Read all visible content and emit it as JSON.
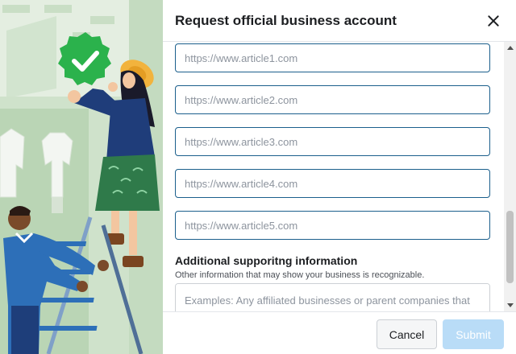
{
  "dialog": {
    "title": "Request official business account",
    "close_label": "close"
  },
  "form": {
    "articles": [
      {
        "placeholder": "https://www.article1.com"
      },
      {
        "placeholder": "https://www.article2.com"
      },
      {
        "placeholder": "https://www.article3.com"
      },
      {
        "placeholder": "https://www.article4.com"
      },
      {
        "placeholder": "https://www.article5.com"
      }
    ],
    "additional": {
      "title": "Additional supporitng information",
      "subtitle": "Other information that may show your business is recognizable.",
      "placeholder": "Examples: Any affiliated businesses or parent companies that have an official What's for business account, brand"
    }
  },
  "footer": {
    "cancel_label": "Cancel",
    "submit_label": "Submit"
  },
  "colors": {
    "input_border": "#1b5f8c",
    "badge_green": "#2bb24c",
    "submit_disabled": "#b9dcf7"
  },
  "icons": {
    "close": "close-icon",
    "verified_badge": "verified-badge-icon"
  }
}
